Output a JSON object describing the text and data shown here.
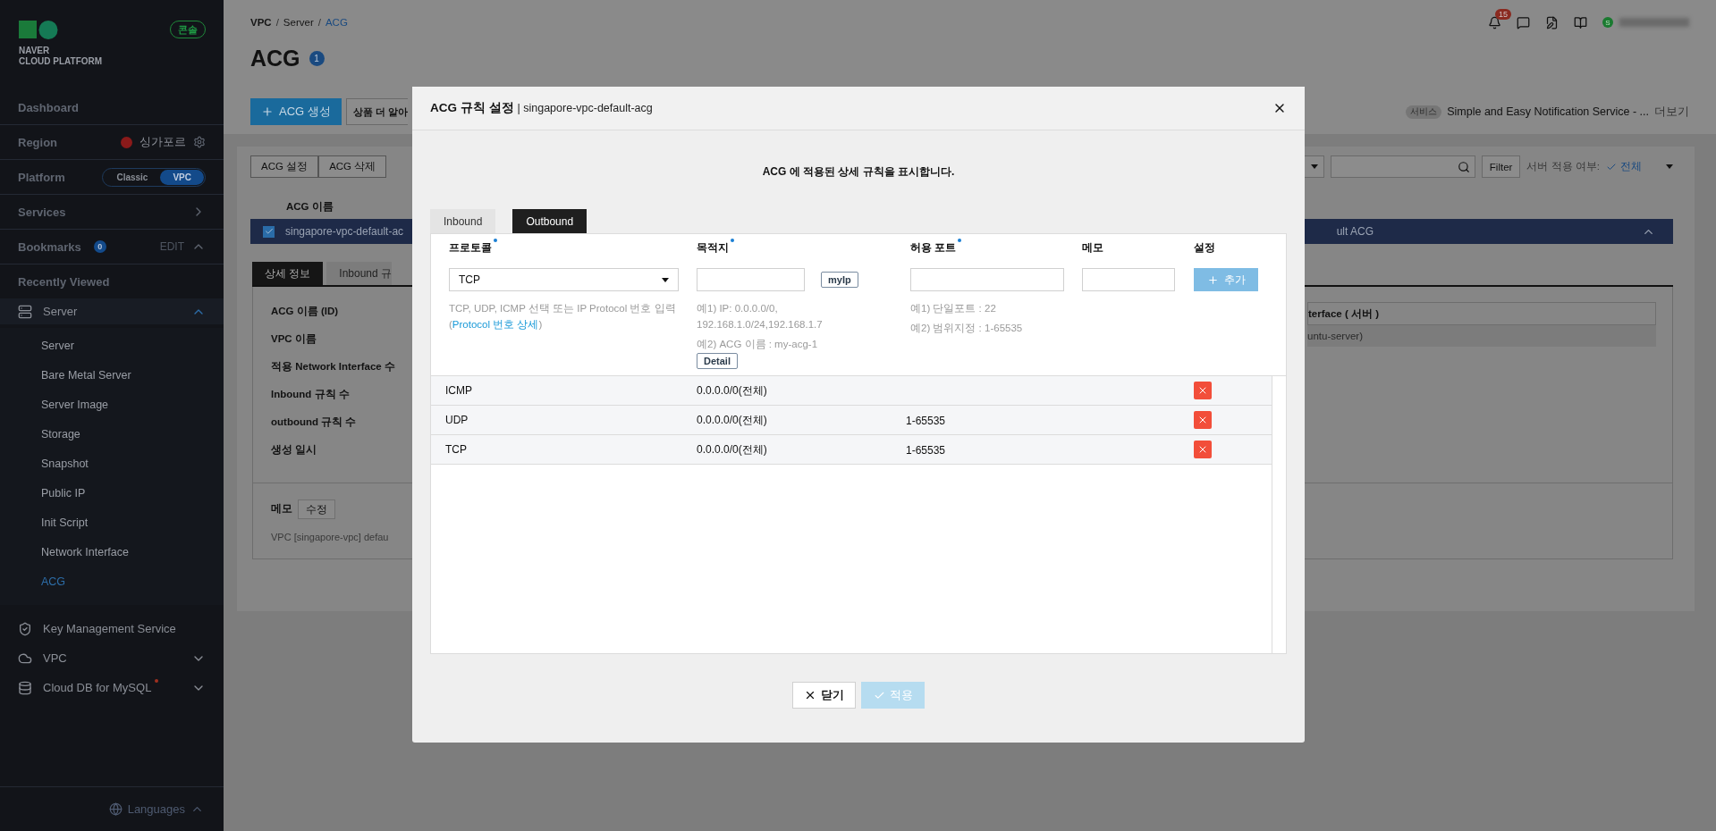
{
  "sidebar": {
    "brand": [
      "NAVER",
      "CLOUD PLATFORM"
    ],
    "console_badge": "콘솔",
    "dashboard": "Dashboard",
    "region": {
      "label": "Region",
      "value": "싱가포르"
    },
    "platform": {
      "label": "Platform",
      "options": [
        {
          "label": "Classic",
          "selected": false
        },
        {
          "label": "VPC",
          "selected": true
        }
      ]
    },
    "services": "Services",
    "bookmarks": {
      "label": "Bookmarks",
      "count": "0",
      "edit": "EDIT"
    },
    "recently_viewed": "Recently Viewed",
    "menu": [
      {
        "label": "Server",
        "kind": "server",
        "expanded": true,
        "dot": false,
        "children": [
          {
            "label": "Server",
            "selected": false
          },
          {
            "label": "Bare Metal Server",
            "selected": false
          },
          {
            "label": "Server Image",
            "selected": false
          },
          {
            "label": "Storage",
            "selected": false
          },
          {
            "label": "Snapshot",
            "selected": false
          },
          {
            "label": "Public IP",
            "selected": false
          },
          {
            "label": "Init Script",
            "selected": false
          },
          {
            "label": "Network Interface",
            "selected": false
          },
          {
            "label": "ACG",
            "selected": true
          }
        ]
      },
      {
        "label": "Key Management Service",
        "kind": "shield",
        "dot": false
      },
      {
        "label": "VPC",
        "kind": "cloud",
        "expanded": false,
        "dot": false
      },
      {
        "label": "Cloud DB for MySQL",
        "kind": "database",
        "expanded": false,
        "dot": true
      }
    ],
    "languages": "Languages"
  },
  "header": {
    "breadcrumb": [
      {
        "label": "VPC",
        "separator": "/"
      },
      {
        "label": "Server",
        "separator": "/"
      },
      {
        "label": "ACG"
      }
    ],
    "title": "ACG",
    "count": "1",
    "notifications": "15",
    "avatar": "S"
  },
  "toolbar": {
    "create": "ACG 생성",
    "learn_more": "상품 더 알아",
    "service_tag": "서비스",
    "service_name": "Simple and Easy Notification Service - ...",
    "more": "더보기"
  },
  "actions": [
    "ACG 설정",
    "ACG 삭제"
  ],
  "filter": {
    "button": "Filter",
    "label": "서버 적용 여부:",
    "value": "전체"
  },
  "list": {
    "column": "ACG 이름",
    "row": {
      "name": "singapore-vpc-default-ac",
      "checked": true,
      "column_2": "ult ACG"
    }
  },
  "detail": {
    "tabs": [
      {
        "label": "상세 정보",
        "selected": true
      },
      {
        "label": "Inbound 규",
        "selected": false
      }
    ],
    "labels": [
      "ACG 이름 (ID)",
      "VPC 이름",
      "적용 Network Interface 수",
      "Inbound 규칙 수",
      "outbound 규칙 수",
      "생성 일시"
    ],
    "memo_label": "메모",
    "memo_edit": "수정",
    "memo_text": "VPC [singapore-vpc] defau",
    "interface_header": "terface ( 서버 )",
    "interface_cell": "untu-server)"
  },
  "modal": {
    "title": "ACG 규칙 설정",
    "subtitle": "| singapore-vpc-default-acg",
    "description": "ACG 에 적용된 상세 규칙을 표시합니다.",
    "tabs": [
      {
        "label": "Inbound",
        "selected": false
      },
      {
        "label": "Outbound",
        "selected": true
      }
    ],
    "columns": [
      {
        "label": "프로토콜",
        "required": true
      },
      {
        "label": "목적지",
        "required": true
      },
      {
        "label": "허용 포트",
        "required": true
      },
      {
        "label": "메모",
        "required": false
      },
      {
        "label": "설정",
        "required": false
      }
    ],
    "form": {
      "protocol": "TCP",
      "protocol_hint": "TCP, UDP, ICMP 선택 또는 IP Protocol 번호 입력",
      "link_prefix": "(",
      "protocol_link": "Protocol 번호 상세",
      "link_suffix": ")",
      "myip": "myIp",
      "destination_hints": [
        "예1) IP: 0.0.0.0/0,",
        "192.168.1.0/24,192.168.1.7",
        "예2) ACG 이름 : my-acg-1"
      ],
      "detail": "Detail",
      "port_hints": [
        "예1) 단일포트 : 22",
        "예2) 범위지정 : 1-65535"
      ],
      "add": {
        "label": "추가",
        "disabled": true
      }
    },
    "rules": [
      {
        "protocol": "ICMP",
        "destination": "0.0.0.0/0(전체)"
      },
      {
        "protocol": "UDP",
        "destination": "0.0.0.0/0(전체)",
        "port": "1-65535"
      },
      {
        "protocol": "TCP",
        "destination": "0.0.0.0/0(전체)",
        "port": "1-65535"
      }
    ],
    "close": "닫기",
    "apply": {
      "label": "적용",
      "disabled": true
    }
  }
}
